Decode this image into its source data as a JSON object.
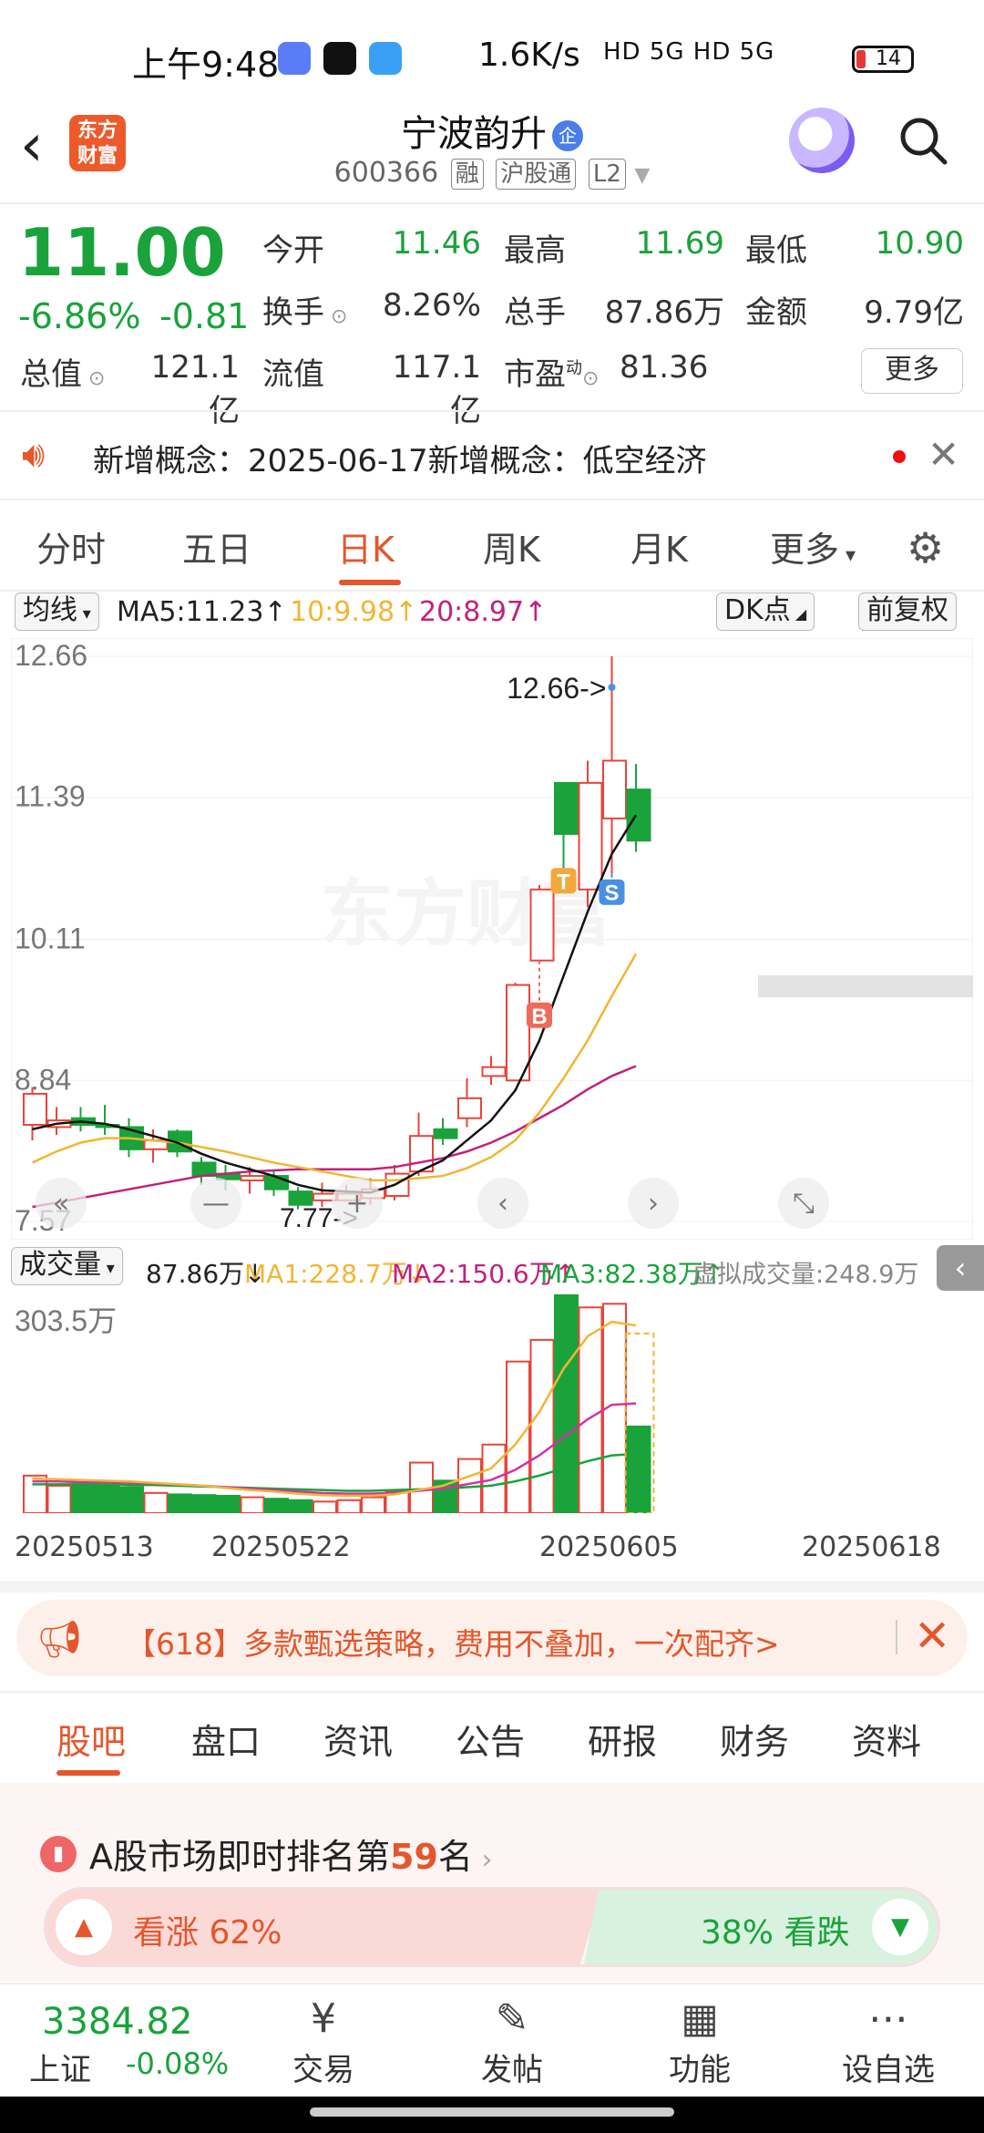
{
  "status": {
    "time": "上午9:48",
    "net": "1.6K/s",
    "rest": "HD 5G HD 5G",
    "battery": "14"
  },
  "header": {
    "back": "‹",
    "logo": "东方\n财富",
    "name": "宁波韵升",
    "name_badge": "企",
    "code": "600366",
    "tags": [
      "融",
      "沪股通",
      "L2"
    ]
  },
  "quote": {
    "price": "11.00",
    "pct": "-6.86%",
    "change": "-0.81",
    "open_label": "今开",
    "open": "11.46",
    "high_label": "最高",
    "high": "11.69",
    "low_label": "最低",
    "low": "10.90",
    "turnover_label": "换手",
    "turnover": "8.26%",
    "volume_label": "总手",
    "volume": "87.86万",
    "amount_label": "金额",
    "amount": "9.79亿",
    "mcap_label": "总值",
    "mcap": "121.1亿",
    "float_label": "流值",
    "float": "117.1亿",
    "pe_label": "市盈",
    "pe_sup": "动",
    "pe": "81.36",
    "more": "更多"
  },
  "notice": {
    "text": "新增概念：2025-06-17新增概念：低空经济"
  },
  "ktabs": [
    "分时",
    "五日",
    "日K",
    "周K",
    "月K",
    "更多"
  ],
  "ma": {
    "select": "均线",
    "ma5": "MA5:11.23",
    "ma10": "10:9.98",
    "ma20": "20:8.97",
    "dk": "DK点",
    "fq": "前复权"
  },
  "chart_data": {
    "type": "candlestick",
    "ylabels": [
      "12.66",
      "11.39",
      "10.11",
      "8.84",
      "7.57"
    ],
    "ylim": [
      7.57,
      12.66
    ],
    "high_marker": "12.66->",
    "low_marker": "7.77->",
    "watermark": "东方财富",
    "candles": [
      {
        "o": 8.44,
        "c": 8.72,
        "h": 8.78,
        "l": 8.3
      },
      {
        "o": 8.42,
        "c": 8.48,
        "h": 8.6,
        "l": 8.35
      },
      {
        "o": 8.5,
        "c": 8.44,
        "h": 8.6,
        "l": 8.38
      },
      {
        "o": 8.44,
        "c": 8.42,
        "h": 8.62,
        "l": 8.35
      },
      {
        "o": 8.42,
        "c": 8.22,
        "h": 8.5,
        "l": 8.15
      },
      {
        "o": 8.22,
        "c": 8.3,
        "h": 8.4,
        "l": 8.1
      },
      {
        "o": 8.38,
        "c": 8.2,
        "h": 8.4,
        "l": 8.15
      },
      {
        "o": 8.1,
        "c": 7.98,
        "h": 8.15,
        "l": 7.9
      },
      {
        "o": 8.0,
        "c": 7.95,
        "h": 8.08,
        "l": 7.85
      },
      {
        "o": 7.94,
        "c": 7.98,
        "h": 8.06,
        "l": 7.82
      },
      {
        "o": 7.98,
        "c": 7.86,
        "h": 8.02,
        "l": 7.8
      },
      {
        "o": 7.84,
        "c": 7.72,
        "h": 7.88,
        "l": 7.68
      },
      {
        "o": 7.76,
        "c": 7.82,
        "h": 7.92,
        "l": 7.7
      },
      {
        "o": 7.76,
        "c": 7.82,
        "h": 7.9,
        "l": 7.77
      },
      {
        "o": 7.78,
        "c": 7.86,
        "h": 7.96,
        "l": 7.72
      },
      {
        "o": 7.8,
        "c": 8.0,
        "h": 8.08,
        "l": 7.76
      },
      {
        "o": 8.02,
        "c": 8.34,
        "h": 8.55,
        "l": 7.98
      },
      {
        "o": 8.4,
        "c": 8.32,
        "h": 8.5,
        "l": 8.26
      },
      {
        "o": 8.5,
        "c": 8.68,
        "h": 8.86,
        "l": 8.42
      },
      {
        "o": 8.88,
        "c": 8.96,
        "h": 9.06,
        "l": 8.8
      },
      {
        "o": 8.84,
        "c": 9.7,
        "h": 9.72,
        "l": 8.84
      },
      {
        "o": 9.92,
        "c": 10.56,
        "h": 10.6,
        "l": 9.92
      },
      {
        "o": 11.52,
        "c": 11.06,
        "h": 11.52,
        "l": 10.72
      },
      {
        "o": 10.56,
        "c": 11.52,
        "h": 11.72,
        "l": 10.4
      },
      {
        "o": 11.2,
        "c": 11.72,
        "h": 12.66,
        "l": 10.7
      },
      {
        "o": 11.46,
        "c": 11.0,
        "h": 11.69,
        "l": 10.9
      }
    ],
    "ma5": [
      8.4,
      8.45,
      8.47,
      8.45,
      8.4,
      8.34,
      8.28,
      8.18,
      8.1,
      8.04,
      7.98,
      7.9,
      7.85,
      7.84,
      7.83,
      7.9,
      8.02,
      8.12,
      8.3,
      8.48,
      8.75,
      9.2,
      9.78,
      10.36,
      10.88,
      11.23
    ],
    "ma10": [
      8.1,
      8.2,
      8.28,
      8.32,
      8.32,
      8.3,
      8.28,
      8.24,
      8.2,
      8.15,
      8.1,
      8.06,
      8.02,
      7.98,
      7.94,
      7.94,
      7.96,
      7.98,
      8.05,
      8.15,
      8.3,
      8.55,
      8.86,
      9.2,
      9.6,
      9.98
    ],
    "ma20": [
      7.7,
      7.74,
      7.78,
      7.82,
      7.86,
      7.9,
      7.94,
      7.98,
      8.0,
      8.02,
      8.03,
      8.04,
      8.04,
      8.04,
      8.04,
      8.06,
      8.1,
      8.14,
      8.2,
      8.28,
      8.38,
      8.5,
      8.62,
      8.76,
      8.88,
      8.97
    ],
    "signals": [
      {
        "label": "B",
        "index": 21,
        "color": "#ef6a5a"
      },
      {
        "label": "T",
        "index": 22,
        "color": "#f2a93b"
      },
      {
        "label": "S",
        "index": 24,
        "color": "#4a90e2"
      }
    ],
    "volume_ylabel": "303.5万",
    "volume": [
      52,
      38,
      40,
      40,
      36,
      28,
      26,
      25,
      24,
      22,
      20,
      18,
      16,
      18,
      22,
      30,
      70,
      45,
      75,
      95,
      210,
      240,
      303,
      285,
      290,
      120
    ],
    "vol_ma1": [
      48,
      47,
      46,
      45,
      44,
      42,
      40,
      38,
      35,
      32,
      30,
      27,
      25,
      24,
      24,
      26,
      32,
      38,
      50,
      62,
      95,
      140,
      200,
      245,
      265,
      260
    ],
    "vol_ma2": [
      44,
      44,
      43,
      43,
      42,
      41,
      40,
      38,
      36,
      34,
      32,
      30,
      28,
      27,
      27,
      28,
      31,
      34,
      40,
      46,
      60,
      80,
      105,
      130,
      150,
      152
    ],
    "vol_ma3": [
      40,
      40,
      40,
      40,
      39,
      39,
      38,
      37,
      36,
      35,
      34,
      33,
      32,
      31,
      31,
      32,
      33,
      34,
      36,
      38,
      44,
      52,
      62,
      72,
      80,
      82
    ]
  },
  "vol": {
    "select": "成交量",
    "v": "87.86万",
    "ma1": "MA1:228.7万",
    "ma2": "MA2:150.6万",
    "ma3": "MA3:82.38万",
    "virtual": "虚拟成交量:248.9万"
  },
  "dates": [
    "20250513",
    "20250522",
    "20250605",
    "20250618"
  ],
  "promo": {
    "text": "【618】多款甄选策略，费用不叠加，一次配齐>"
  },
  "ntabs": [
    "股吧",
    "盘口",
    "资讯",
    "公告",
    "研报",
    "财务",
    "资料"
  ],
  "rank": {
    "prefix": "A股市场即时排名第",
    "num": "59",
    "suffix": "名"
  },
  "vote": {
    "up": "看涨 62%",
    "down": "38% 看跌"
  },
  "bottom": {
    "index_value": "3384.82",
    "index_name": "上证",
    "index_change": "-0.08%",
    "items": [
      {
        "icon": "¥",
        "label": "交易"
      },
      {
        "icon": "✎",
        "label": "发帖"
      },
      {
        "icon": "▦",
        "label": "功能"
      },
      {
        "icon": "⋯",
        "label": "设自选"
      }
    ]
  },
  "colors": {
    "up": "#e8443a",
    "down": "#19a33a",
    "accent": "#e4562c",
    "ma5": "#111111",
    "ma10": "#f2b534",
    "ma20": "#c2207c"
  }
}
